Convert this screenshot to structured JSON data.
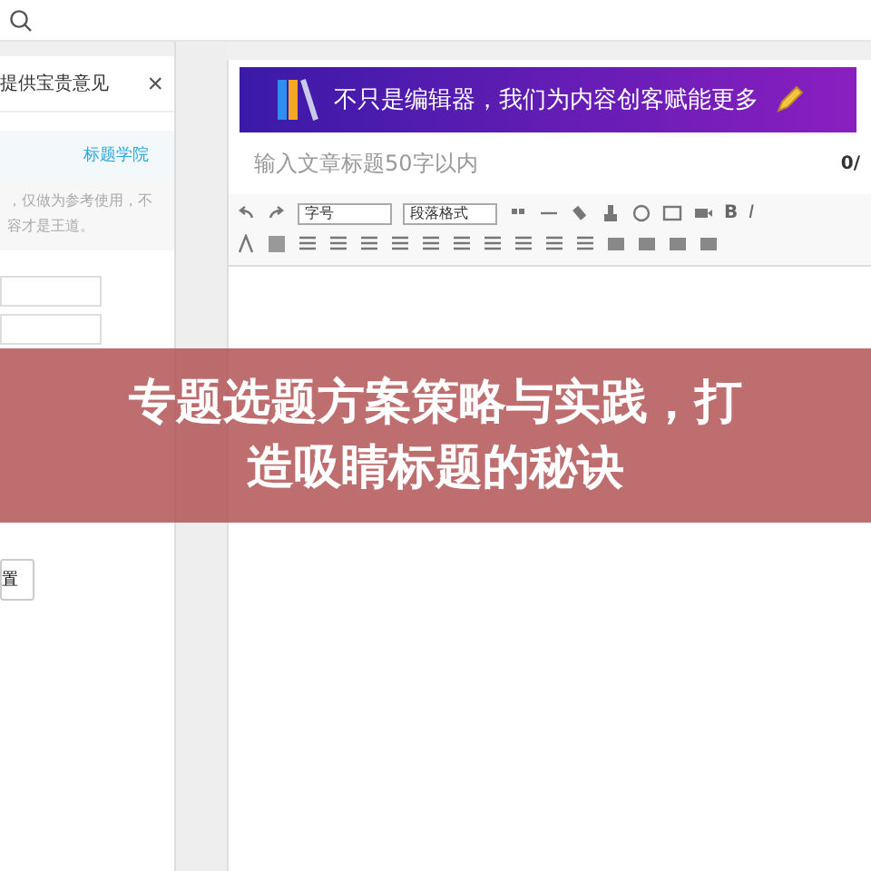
{
  "side_panel": {
    "title": "提供宝贵意见",
    "close": "×",
    "tabs": [
      {
        "label": "标题学院",
        "selected": true
      }
    ],
    "notice": [
      "，仅做为参考使用，不",
      "容才是王道。"
    ],
    "fields": [
      {
        "kind": "text"
      },
      {
        "kind": "text"
      }
    ],
    "button": "置"
  },
  "editor": {
    "promo": "不只是编辑器，我们为内容创客赋能更多",
    "title_placeholder": "输入文章标题50字以内",
    "counter": "0/",
    "selects": [
      "字号",
      "段落格式"
    ],
    "format_letters": [
      "B",
      "I"
    ]
  },
  "overlay": {
    "lines": [
      "专题选题方案策略与实践，打",
      "造吸睛标题的秘诀"
    ]
  }
}
